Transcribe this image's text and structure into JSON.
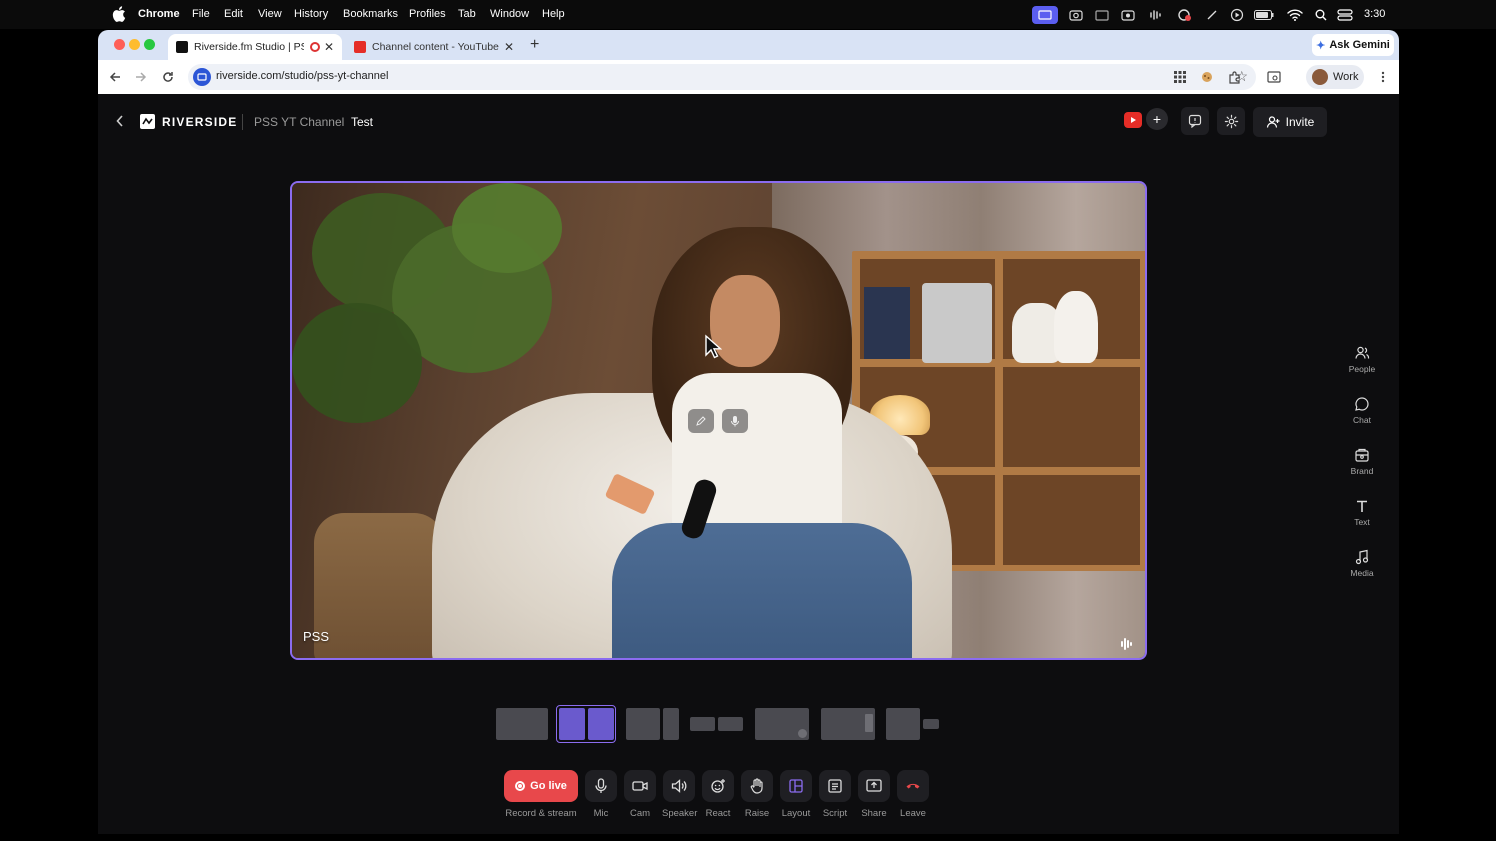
{
  "menubar": {
    "app_name": "Chrome",
    "menus": [
      "File",
      "Edit",
      "View",
      "History",
      "Bookmarks",
      "Profiles",
      "Tab",
      "Window",
      "Help"
    ],
    "clock": "3:30"
  },
  "browser": {
    "tabs": [
      {
        "title": "Riverside.fm Studio | PSS",
        "active": true
      },
      {
        "title": "Channel content - YouTube St",
        "active": false
      }
    ],
    "new_tab": "+",
    "ask_gemini": "Ask Gemini",
    "url": "riverside.com/studio/pss-yt-channel",
    "profile_label": "Work"
  },
  "studio": {
    "logo_text": "RIVERSIDE",
    "breadcrumb_channel": "PSS YT Channel",
    "breadcrumb_session": "Test",
    "invite_label": "Invite",
    "participant_name": "PSS",
    "accent_color": "#8b6cf0",
    "golive_color": "#e8484b"
  },
  "controls": [
    {
      "label": "Mic",
      "icon": "mic-icon"
    },
    {
      "label": "Cam",
      "icon": "camera-icon"
    },
    {
      "label": "Speaker",
      "icon": "speaker-icon"
    },
    {
      "label": "React",
      "icon": "react-icon"
    },
    {
      "label": "Raise",
      "icon": "hand-icon"
    },
    {
      "label": "Layout",
      "icon": "layout-icon"
    },
    {
      "label": "Script",
      "icon": "script-icon"
    },
    {
      "label": "Share",
      "icon": "share-icon"
    },
    {
      "label": "Leave",
      "icon": "leave-icon"
    }
  ],
  "go_live": {
    "button": "Go live",
    "caption": "Record & stream"
  },
  "sidebar": [
    {
      "label": "People",
      "icon": "people-icon"
    },
    {
      "label": "Chat",
      "icon": "chat-icon"
    },
    {
      "label": "Brand",
      "icon": "brand-icon"
    },
    {
      "label": "Text",
      "icon": "text-icon"
    },
    {
      "label": "Media",
      "icon": "media-icon"
    }
  ],
  "layouts": [
    "single",
    "side-by-side",
    "main-plus-side",
    "two-up-wide",
    "speaker-with-pip",
    "main-with-strip",
    "small-tiles"
  ],
  "selected_layout": "side-by-side"
}
